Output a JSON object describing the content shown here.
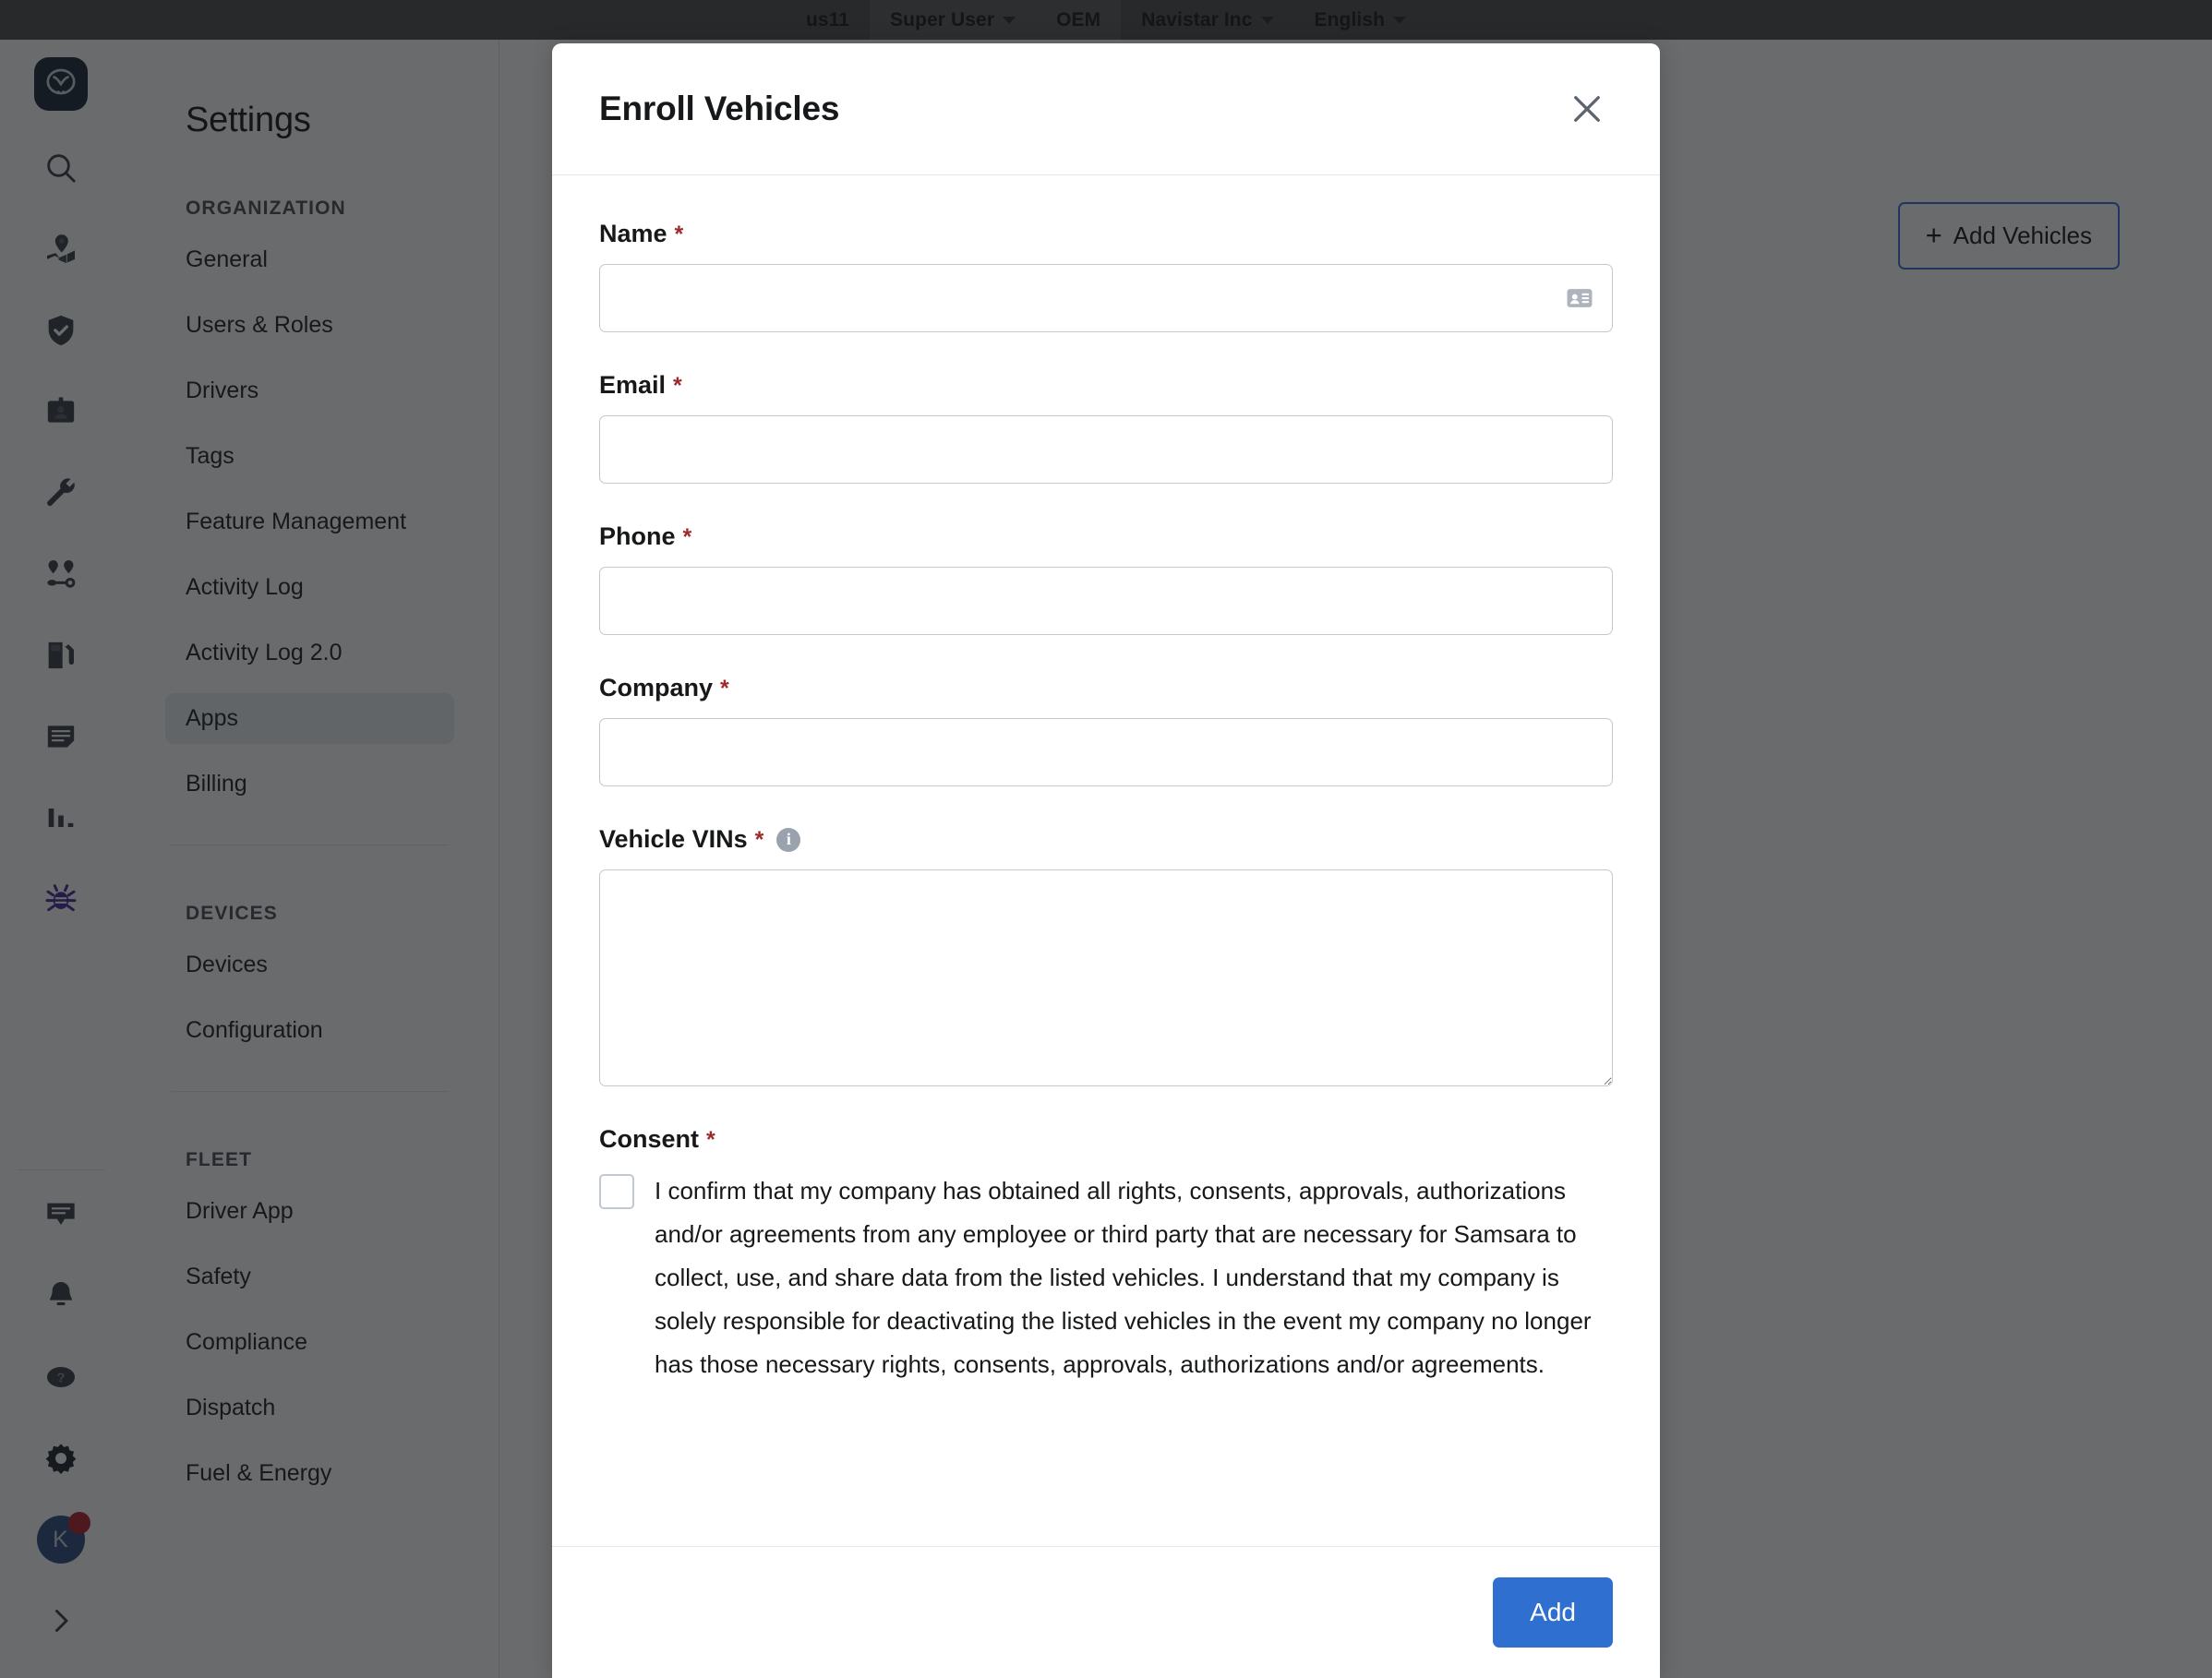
{
  "topbar": {
    "items": [
      {
        "label": "us11",
        "caret": false,
        "highlight": false
      },
      {
        "label": "Super User",
        "caret": true,
        "highlight": true
      },
      {
        "label": "OEM",
        "caret": false,
        "highlight": true
      },
      {
        "label": "Navistar Inc",
        "caret": true,
        "highlight": false
      },
      {
        "label": "English",
        "caret": true,
        "highlight": false
      }
    ]
  },
  "rail": {
    "logo_icon": "samsara-logo-icon",
    "top_icons": [
      "search-icon",
      "map-pin-icon",
      "shield-check-icon",
      "id-badge-icon",
      "wrench-icon",
      "route-icon",
      "fuel-pump-icon",
      "document-icon",
      "bar-chart-icon",
      "bug-icon"
    ],
    "bottom_icons": [
      "chat-icon",
      "bell-icon",
      "help-circle-icon",
      "gear-icon"
    ],
    "avatar_initial": "K",
    "expand_icon": "chevron-right-icon"
  },
  "settings": {
    "title": "Settings",
    "groups": [
      {
        "label": "ORGANIZATION",
        "items": [
          {
            "label": "General",
            "active": false
          },
          {
            "label": "Users & Roles",
            "active": false
          },
          {
            "label": "Drivers",
            "active": false
          },
          {
            "label": "Tags",
            "active": false
          },
          {
            "label": "Feature Management",
            "active": false
          },
          {
            "label": "Activity Log",
            "active": false
          },
          {
            "label": "Activity Log 2.0",
            "active": false
          },
          {
            "label": "Apps",
            "active": true
          },
          {
            "label": "Billing",
            "active": false
          }
        ]
      },
      {
        "label": "DEVICES",
        "items": [
          {
            "label": "Devices",
            "active": false
          },
          {
            "label": "Configuration",
            "active": false
          }
        ]
      },
      {
        "label": "FLEET",
        "items": [
          {
            "label": "Driver App",
            "active": false
          },
          {
            "label": "Safety",
            "active": false
          },
          {
            "label": "Compliance",
            "active": false
          },
          {
            "label": "Dispatch",
            "active": false
          },
          {
            "label": "Fuel & Energy",
            "active": false
          }
        ]
      }
    ]
  },
  "main": {
    "add_vehicles_label": "Add Vehicles",
    "add_vehicles_plus": "+"
  },
  "modal": {
    "title": "Enroll Vehicles",
    "close_icon": "close-icon",
    "required_marker": "*",
    "fields": [
      {
        "label": "Name",
        "required": true,
        "value": "",
        "placeholder": "",
        "icon": "contact-card-icon"
      },
      {
        "label": "Email",
        "required": true,
        "value": "",
        "placeholder": ""
      },
      {
        "label": "Phone",
        "required": true,
        "value": "",
        "placeholder": ""
      },
      {
        "label": "Company",
        "required": true,
        "value": "",
        "placeholder": ""
      },
      {
        "label": "Vehicle VINs",
        "required": true,
        "value": "",
        "placeholder": "",
        "info_icon": "info-icon",
        "info_glyph": "i"
      }
    ],
    "consent": {
      "label": "Consent",
      "required": true,
      "checked": false,
      "text": "I confirm that my company has obtained all rights, consents, approvals, authorizations and/or agreements from any employee or third party that are necessary for Samsara to collect, use, and share data from the listed vehicles. I understand that my company is solely responsible for deactivating the listed vehicles in the event my company no longer has those necessary rights, consents, approvals, authorizations and/or agreements."
    },
    "submit_label": "Add"
  },
  "colors": {
    "primary": "#2f6fd0",
    "required": "#9e2a2b",
    "topbar_bg": "#4c4c4e",
    "overlay": "rgba(18,20,22,0.63)",
    "accent_border": "#3a6fd8"
  }
}
